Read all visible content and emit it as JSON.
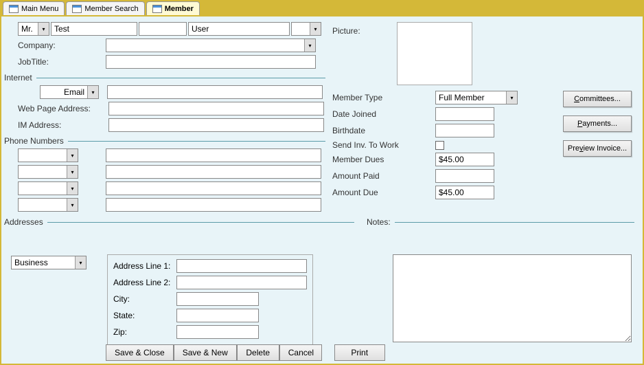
{
  "tabs": [
    {
      "label": "Main Menu",
      "active": false
    },
    {
      "label": "Member Search",
      "active": false
    },
    {
      "label": "Member",
      "active": true
    }
  ],
  "name": {
    "title": "Mr.",
    "first": "Test",
    "middle": "",
    "last": "User",
    "suffix": ""
  },
  "companyLabel": "Company:",
  "company": "",
  "jobTitleLabel": "JobTitle:",
  "jobTitle": "",
  "pictureLabel": "Picture:",
  "sections": {
    "internet": "Internet",
    "phone": "Phone Numbers",
    "addresses": "Addresses",
    "notes": "Notes:"
  },
  "internet": {
    "emailType": "Email",
    "email": "",
    "webLabel": "Web Page Address:",
    "web": "",
    "imLabel": "IM Address:",
    "im": ""
  },
  "phones": [
    {
      "type": "",
      "number": ""
    },
    {
      "type": "",
      "number": ""
    },
    {
      "type": "",
      "number": ""
    },
    {
      "type": "",
      "number": ""
    }
  ],
  "member": {
    "typeLabel": "Member Type",
    "type": "Full Member",
    "dateJoinedLabel": "Date Joined",
    "dateJoined": "",
    "birthdateLabel": "Birthdate",
    "birthdate": "",
    "sendInvLabel": "Send Inv. To Work",
    "sendInv": false,
    "duesLabel": "Member Dues",
    "dues": "$45.00",
    "paidLabel": "Amount Paid",
    "paid": "",
    "dueLabel": "Amount Due",
    "due": "$45.00"
  },
  "sideButtons": {
    "committees": "ommittees...",
    "committeesKey": "C",
    "payments": "ayments...",
    "paymentsKey": "P",
    "preview": "Pre",
    "previewKey": "v",
    "previewRest": "iew Invoice..."
  },
  "addressType": "Business",
  "address": {
    "line1Label": "Address Line 1:",
    "line1": "",
    "line2Label": "Address Line 2:",
    "line2": "",
    "cityLabel": "City:",
    "city": "",
    "stateLabel": "State:",
    "state": "",
    "zipLabel": "Zip:",
    "zip": ""
  },
  "notes": "",
  "buttons": {
    "saveClose": "Save & Close",
    "saveNew": "Save & New",
    "delete": "Delete",
    "cancel": "Cancel",
    "print": "Print"
  }
}
